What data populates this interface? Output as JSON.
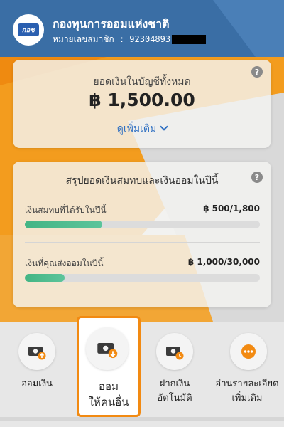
{
  "header": {
    "logo_text": "กอช",
    "org_name": "กองทุนการออมแห่งชาติ",
    "member_label": "หมายเลขสมาชิก : 92304893"
  },
  "balance_card": {
    "label": "ยอดเงินในบัญชีทั้งหมด",
    "amount": "฿ 1,500.00",
    "more_label": "ดูเพิ่มเติม"
  },
  "summary_card": {
    "title": "สรุปยอดเงินสมทบและเงินออมในปีนี้",
    "rows": [
      {
        "label": "เงินสมทบที่ได้รับในปีนี้",
        "value": "฿ 500/1,800",
        "progress": 0.33
      },
      {
        "label": "เงินที่คุณส่งออมในปีนี้",
        "value": "฿ 1,000/30,000",
        "progress": 0.17
      }
    ]
  },
  "actions": [
    {
      "label": "ออมเงิน",
      "icon": "money-up-icon"
    },
    {
      "label_line1": "ออม",
      "label_line2": "ให้คนอื่น",
      "icon": "money-down-icon"
    },
    {
      "label_line1": "ฝากเงิน",
      "label_line2": "อัตโนมัติ",
      "icon": "money-clock-icon"
    },
    {
      "label_line1": "อ่านรายละเอียด",
      "label_line2": "เพิ่มเติม",
      "icon": "more-dots-icon"
    }
  ],
  "colors": {
    "header_blue": "#3a6ea5",
    "accent_orange": "#f28a12",
    "progress_green": "#43b584",
    "link_blue": "#2e6fc2"
  }
}
